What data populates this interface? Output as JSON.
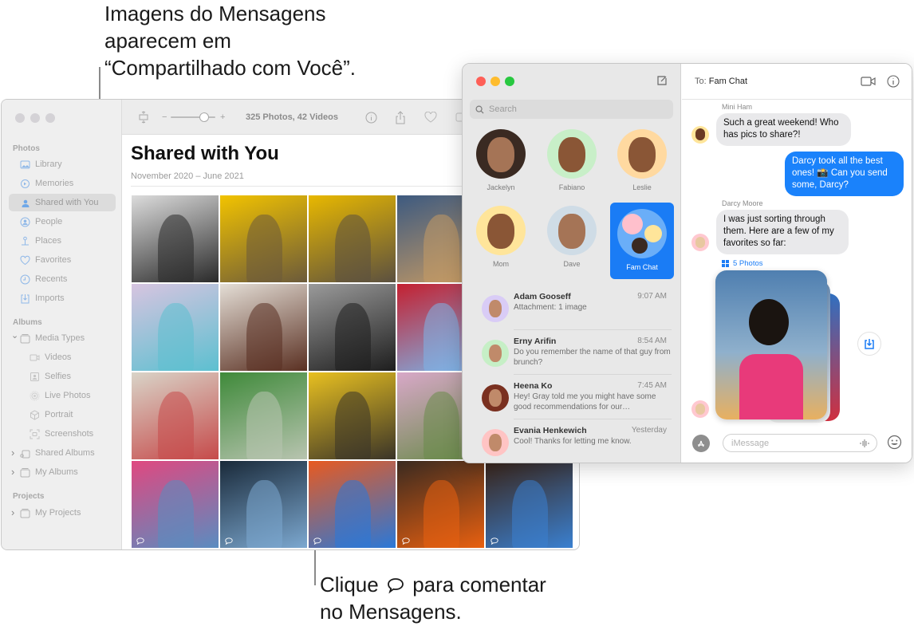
{
  "callouts": {
    "top": [
      "Imagens do Mensagens",
      "aparecem em",
      "“Compartilhado com Você”."
    ],
    "bottom_before_icon": "Clique",
    "bottom_icon": "speech-bubble-icon",
    "bottom_after_icon": "para comentar",
    "bottom_line2": "no Mensagens."
  },
  "photos": {
    "sidebar": {
      "sections": [
        "Photos",
        "Albums",
        "Projects"
      ],
      "photos_items": [
        {
          "label": "Library",
          "icon": "library-icon"
        },
        {
          "label": "Memories",
          "icon": "memories-icon"
        },
        {
          "label": "Shared with You",
          "icon": "shared-with-you-icon",
          "selected": true
        },
        {
          "label": "People",
          "icon": "people-icon"
        },
        {
          "label": "Places",
          "icon": "places-icon"
        },
        {
          "label": "Favorites",
          "icon": "heart-icon"
        },
        {
          "label": "Recents",
          "icon": "clock-icon"
        },
        {
          "label": "Imports",
          "icon": "import-icon"
        }
      ],
      "albums_items": [
        {
          "label": "Media Types",
          "icon": "folder-icon",
          "expanded": true
        },
        {
          "label": "Videos",
          "icon": "video-icon"
        },
        {
          "label": "Selfies",
          "icon": "selfie-icon"
        },
        {
          "label": "Live Photos",
          "icon": "live-photo-icon"
        },
        {
          "label": "Portrait",
          "icon": "portrait-cube-icon"
        },
        {
          "label": "Screenshots",
          "icon": "screenshot-icon"
        },
        {
          "label": "Shared Albums",
          "icon": "shared-folder-icon",
          "expanded": false
        },
        {
          "label": "My Albums",
          "icon": "folder-icon",
          "expanded": false
        }
      ],
      "projects_items": [
        {
          "label": "My Projects",
          "icon": "folder-icon",
          "expanded": false
        }
      ]
    },
    "toolbar": {
      "zoom_minus": "−",
      "zoom_plus": "+",
      "zoom_level": 0.75,
      "count": "325 Photos, 42 Videos"
    },
    "title": "Shared with You",
    "date_range": "November 2020 – June 2021",
    "tiles": [
      {
        "desc": "bw-silhouette",
        "colors": [
          "#2a2a2a",
          "#dcdcdc"
        ]
      },
      {
        "desc": "child-yellow-float",
        "colors": [
          "#6b5a3a",
          "#f2c300"
        ]
      },
      {
        "desc": "child-splashing",
        "colors": [
          "#5b5040",
          "#e8b800"
        ]
      },
      {
        "desc": "man-sitting",
        "colors": [
          "#c59a64",
          "#3d5a80"
        ]
      },
      {
        "desc": "floral-fabric",
        "colors": [
          "#5cc0d0",
          "#d7c4e0"
        ]
      },
      {
        "desc": "fruit-bowl",
        "colors": [
          "#5a3022",
          "#e4ded6"
        ]
      },
      {
        "desc": "bw-woman-curls",
        "colors": [
          "#1e1e1e",
          "#9a9a9a"
        ]
      },
      {
        "desc": "woman-red-pants",
        "colors": [
          "#7db4e8",
          "#c42030"
        ]
      },
      {
        "desc": "painted-poles",
        "colors": [
          "#c64a4a",
          "#d9d4c8"
        ]
      },
      {
        "desc": "leaves-glass",
        "colors": [
          "#b8c4b0",
          "#3f8a3a"
        ]
      },
      {
        "desc": "yellow-bowl",
        "colors": [
          "#3a3428",
          "#e8c020"
        ]
      },
      {
        "desc": "family-park",
        "colors": [
          "#6a8a4a",
          "#d8a8c8"
        ]
      },
      {
        "desc": "woman-sunset",
        "colors": [
          "#5a8cc0",
          "#e04880"
        ],
        "comment": true
      },
      {
        "desc": "family-beach",
        "colors": [
          "#7ca8d0",
          "#1a2a3a"
        ],
        "comment": true
      },
      {
        "desc": "boy-umbrella",
        "colors": [
          "#2a78d8",
          "#e85a20"
        ],
        "comment": true
      },
      {
        "desc": "man-orange-umbrella",
        "colors": [
          "#e86010",
          "#3a2a20"
        ],
        "comment": true
      },
      {
        "desc": "father-son",
        "colors": [
          "#3a80d0",
          "#3a2418"
        ],
        "comment": true
      }
    ]
  },
  "messages": {
    "traffic_colors": [
      "#fe5f57",
      "#febc2e",
      "#28c840"
    ],
    "search_placeholder": "Search",
    "pinned": [
      {
        "name": "Jackelyn",
        "bg": "#3a2a22"
      },
      {
        "name": "Fabiano",
        "bg": "#c8efc8"
      },
      {
        "name": "Leslie",
        "bg": "#ffd9a0"
      },
      {
        "name": "Mom",
        "bg": "#ffe59a"
      },
      {
        "name": "Dave",
        "bg": "#cfdce6"
      },
      {
        "name": "Fam Chat",
        "bg": "#6aaef8",
        "selected": true
      }
    ],
    "chats": [
      {
        "name": "Adam Gooseff",
        "time": "9:07 AM",
        "preview": "Attachment: 1 image",
        "bg": "#d9ccf6"
      },
      {
        "name": "Erny Arifin",
        "time": "8:54 AM",
        "preview": "Do you remember the name of that guy from brunch?",
        "bg": "#c6efc6"
      },
      {
        "name": "Heena Ko",
        "time": "7:45 AM",
        "preview": "Hey! Gray told me you might have some good recommendations for our…",
        "bg": "#7a3020"
      },
      {
        "name": "Evania Henkewich",
        "time": "Yesterday",
        "preview": "Cool! Thanks for letting me know.",
        "bg": "#ffc4c4"
      }
    ],
    "conversation": {
      "to_label": "To:",
      "to_name": "Fam Chat",
      "messages": [
        {
          "sender": "Mini Ham",
          "text": "Such a great weekend! Who has pics to share?!",
          "direction": "in"
        },
        {
          "text": "Darcy took all the best ones! 📸 Can you send some, Darcy?",
          "direction": "out"
        },
        {
          "sender": "Darcy Moore",
          "text": "I was just sorting through them. Here are a few of my favorites so far:",
          "direction": "in"
        }
      ],
      "photos_link": "5 Photos",
      "input_placeholder": "iMessage"
    },
    "accent": "#1a82fb"
  }
}
